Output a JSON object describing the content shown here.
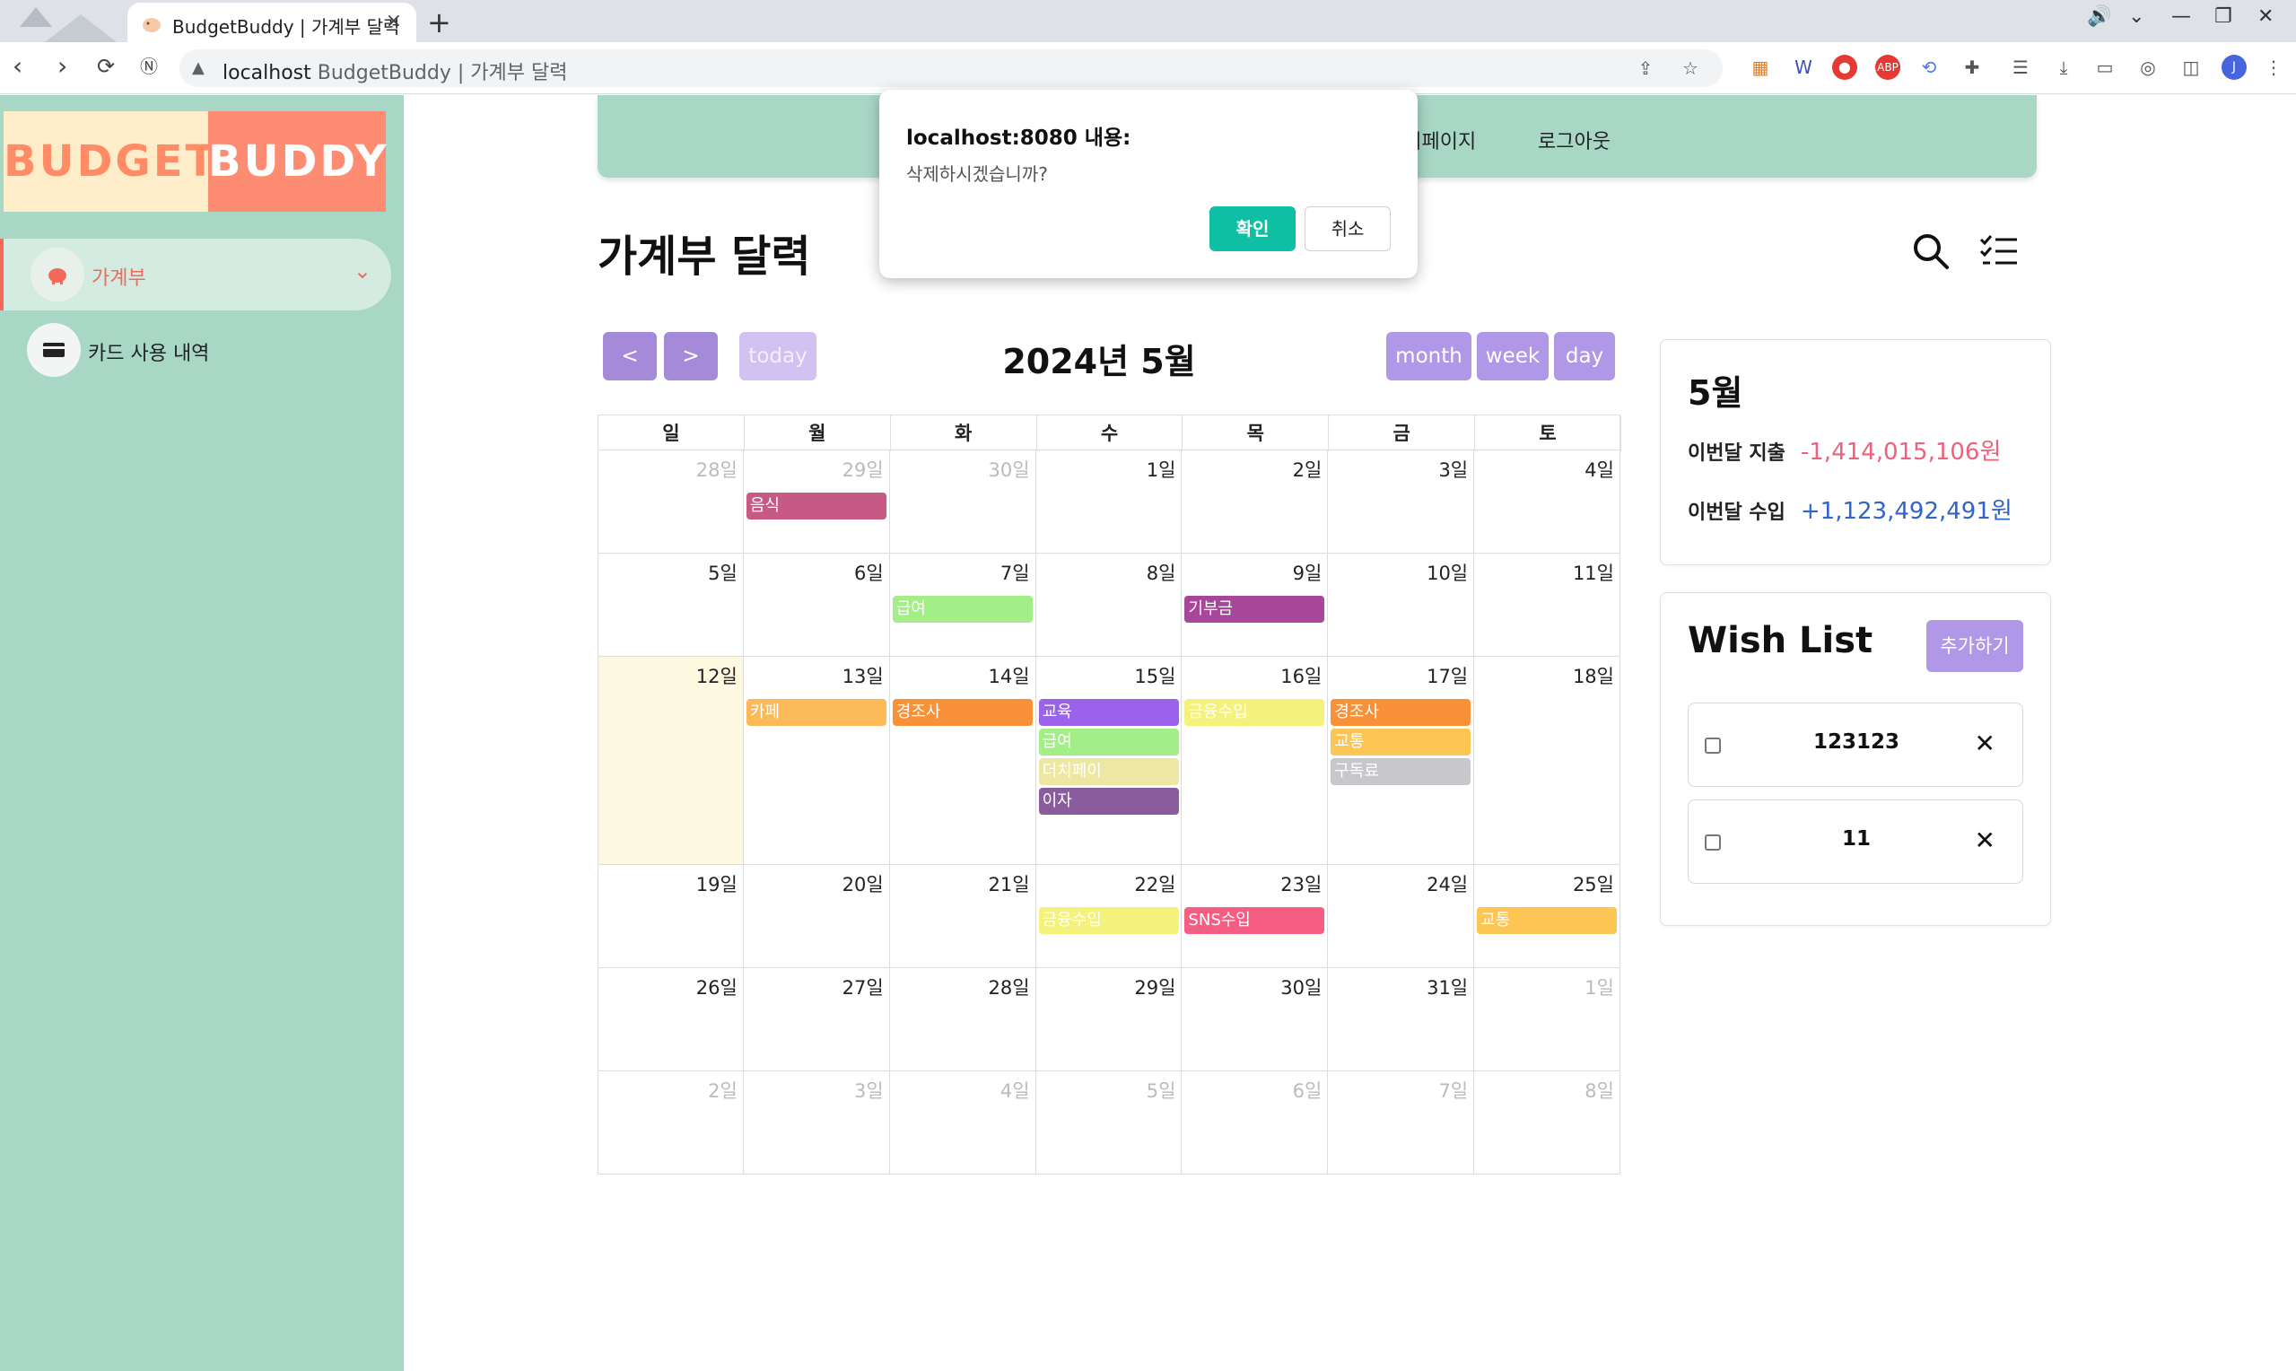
{
  "browser": {
    "tab_title": "BudgetBuddy | 가계부 달력",
    "url_host": "localhost",
    "url_title": "BudgetBuddy | 가계부 달력"
  },
  "sidebar": {
    "logo_left": "BUDGET",
    "logo_right": "BUDDY",
    "items": [
      {
        "label": "가계부",
        "icon": "piggy-bank-icon"
      },
      {
        "label": "카드 사용 내역",
        "icon": "credit-card-icon"
      }
    ]
  },
  "topnav": {
    "mypage": "마이페이지",
    "logout": "로그아웃"
  },
  "page": {
    "title": "가계부 달력"
  },
  "calendar": {
    "title": "2024년 5월",
    "today_label": "today",
    "views": [
      "month",
      "week",
      "day"
    ],
    "weekdays": [
      "일",
      "월",
      "화",
      "수",
      "목",
      "금",
      "토"
    ],
    "weeks": [
      [
        {
          "d": "28일",
          "other": true,
          "events": []
        },
        {
          "d": "29일",
          "other": true,
          "events": [
            {
              "t": "음식",
              "c": "#c75a85"
            }
          ]
        },
        {
          "d": "30일",
          "other": true,
          "events": []
        },
        {
          "d": "1일",
          "events": []
        },
        {
          "d": "2일",
          "events": []
        },
        {
          "d": "3일",
          "events": []
        },
        {
          "d": "4일",
          "events": []
        }
      ],
      [
        {
          "d": "5일",
          "events": []
        },
        {
          "d": "6일",
          "events": []
        },
        {
          "d": "7일",
          "events": [
            {
              "t": "급여",
              "c": "#a3ee87"
            }
          ]
        },
        {
          "d": "8일",
          "events": []
        },
        {
          "d": "9일",
          "events": [
            {
              "t": "기부금",
              "c": "#a8479a"
            }
          ]
        },
        {
          "d": "10일",
          "events": []
        },
        {
          "d": "11일",
          "events": []
        }
      ],
      [
        {
          "d": "12일",
          "today": true,
          "events": []
        },
        {
          "d": "13일",
          "events": [
            {
              "t": "카페",
              "c": "#fbb957"
            }
          ]
        },
        {
          "d": "14일",
          "events": [
            {
              "t": "경조사",
              "c": "#f89138"
            }
          ]
        },
        {
          "d": "15일",
          "events": [
            {
              "t": "교육",
              "c": "#9b62ec"
            },
            {
              "t": "급여",
              "c": "#a3ee87"
            },
            {
              "t": "더치페이",
              "c": "#ede7a4"
            },
            {
              "t": "이자",
              "c": "#8a5c9e"
            }
          ]
        },
        {
          "d": "16일",
          "events": [
            {
              "t": "금융수입",
              "c": "#f4f27a"
            }
          ]
        },
        {
          "d": "17일",
          "events": [
            {
              "t": "경조사",
              "c": "#f89138"
            },
            {
              "t": "교통",
              "c": "#fcc554"
            },
            {
              "t": "구독료",
              "c": "#c8c7cb"
            }
          ]
        },
        {
          "d": "18일",
          "events": []
        }
      ],
      [
        {
          "d": "19일",
          "events": []
        },
        {
          "d": "20일",
          "events": []
        },
        {
          "d": "21일",
          "events": []
        },
        {
          "d": "22일",
          "events": [
            {
              "t": "금융수입",
              "c": "#f4f27a"
            }
          ]
        },
        {
          "d": "23일",
          "events": [
            {
              "t": "SNS수입",
              "c": "#f55d83"
            }
          ]
        },
        {
          "d": "24일",
          "events": []
        },
        {
          "d": "25일",
          "events": [
            {
              "t": "교통",
              "c": "#fcc554"
            }
          ]
        }
      ],
      [
        {
          "d": "26일",
          "events": []
        },
        {
          "d": "27일",
          "events": []
        },
        {
          "d": "28일",
          "events": []
        },
        {
          "d": "29일",
          "events": []
        },
        {
          "d": "30일",
          "events": []
        },
        {
          "d": "31일",
          "events": []
        },
        {
          "d": "1일",
          "other": true,
          "events": []
        }
      ],
      [
        {
          "d": "2일",
          "other": true,
          "events": []
        },
        {
          "d": "3일",
          "other": true,
          "events": []
        },
        {
          "d": "4일",
          "other": true,
          "events": []
        },
        {
          "d": "5일",
          "other": true,
          "events": []
        },
        {
          "d": "6일",
          "other": true,
          "events": []
        },
        {
          "d": "7일",
          "other": true,
          "events": []
        },
        {
          "d": "8일",
          "other": true,
          "events": []
        }
      ]
    ]
  },
  "summary": {
    "month": "5월",
    "expense_label": "이번달 지출",
    "expense_value": "-1,414,015,106원",
    "income_label": "이번달 수입",
    "income_value": "+1,123,492,491원",
    "expense_color": "#f0607a",
    "income_color": "#2f64c8"
  },
  "wishlist": {
    "title": "Wish List",
    "add_label": "추가하기",
    "items": [
      {
        "name": "123123",
        "checked": false
      },
      {
        "name": "11",
        "checked": false
      }
    ]
  },
  "dialog": {
    "title": "localhost:8080 내용:",
    "message": "삭제하시겠습니까?",
    "ok": "확인",
    "cancel": "취소"
  }
}
